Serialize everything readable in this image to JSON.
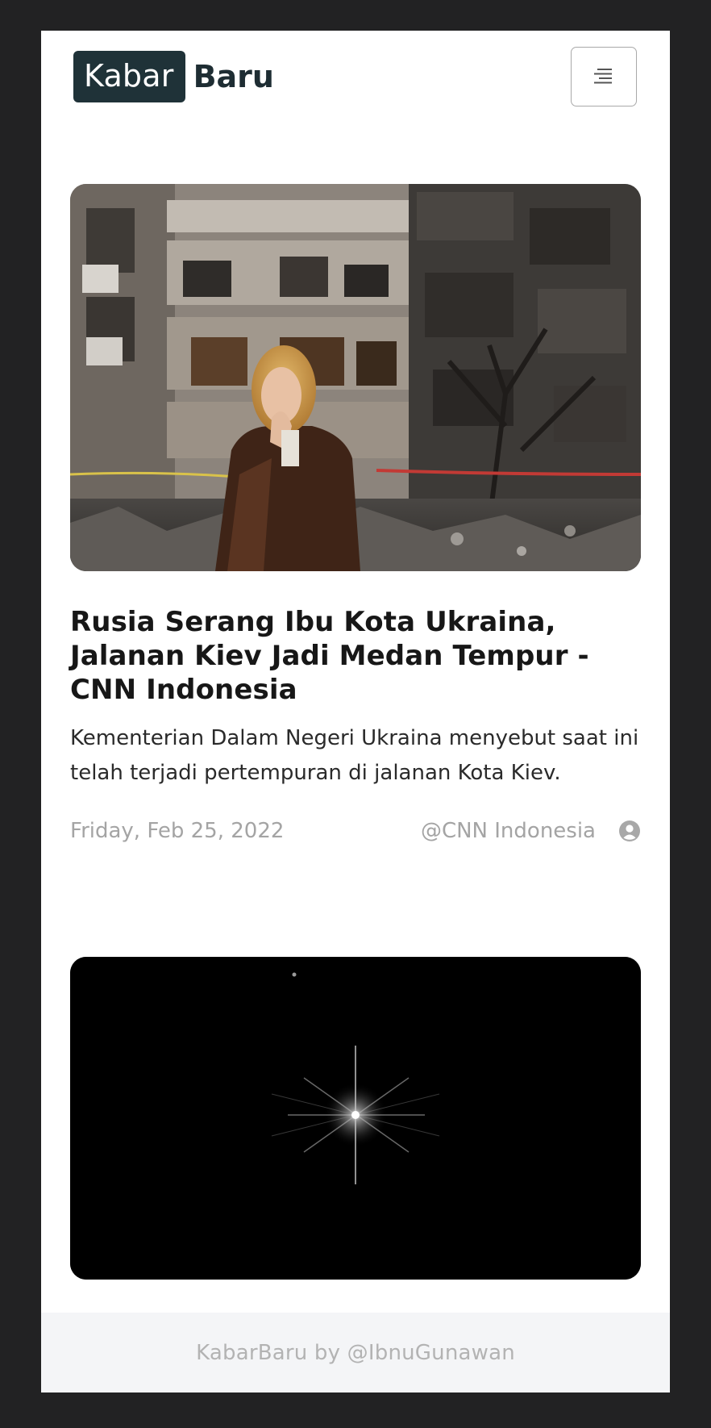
{
  "header": {
    "logo_part1": "Kabar",
    "logo_part2": "Baru",
    "menu_icon": "hamburger-menu-icon"
  },
  "articles": [
    {
      "image_icon": "news-photo",
      "title": "Rusia Serang Ibu Kota Ukraina, Jalanan Kiev Jadi Medan Tempur - CNN Indonesia",
      "summary": "Kementerian Dalam Negeri Ukraina menyebut saat ini telah terjadi pertempuran di jalanan Kota Kiev.",
      "date": "Friday, Feb 25, 2022",
      "source": "@CNN Indonesia",
      "source_icon": "user-circle-icon"
    },
    {
      "image_icon": "news-photo"
    }
  ],
  "footer": {
    "text": "KabarBaru by @IbnuGunawan"
  },
  "colors": {
    "background": "#222223",
    "logo_box": "#1f3238",
    "meta_text": "#a4a4a4",
    "footer_bg": "#f4f5f7"
  }
}
